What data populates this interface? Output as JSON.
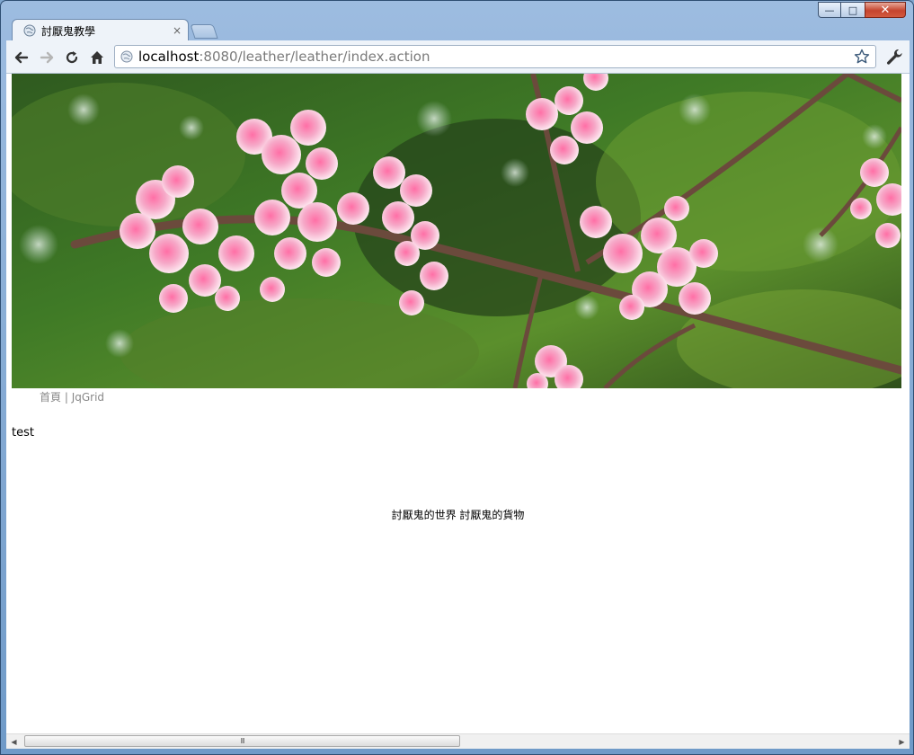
{
  "window": {
    "minimize_label": "—",
    "maximize_label": "□",
    "close_label": "✕"
  },
  "tab": {
    "title": "討厭鬼教學",
    "close_label": "×"
  },
  "address": {
    "host": "localhost",
    "path": ":8080/leather/leather/index.action"
  },
  "nav": {
    "home_link": "首頁",
    "separator": " | ",
    "jqgrid_link": "JqGrid"
  },
  "content": {
    "test_text": "test",
    "footer_text": "討厭鬼的世界 討厭鬼的貨物"
  },
  "scrollbar": {
    "grip": "III"
  },
  "colors": {
    "accent": "#6f9ac8",
    "link_gray": "#888888"
  }
}
